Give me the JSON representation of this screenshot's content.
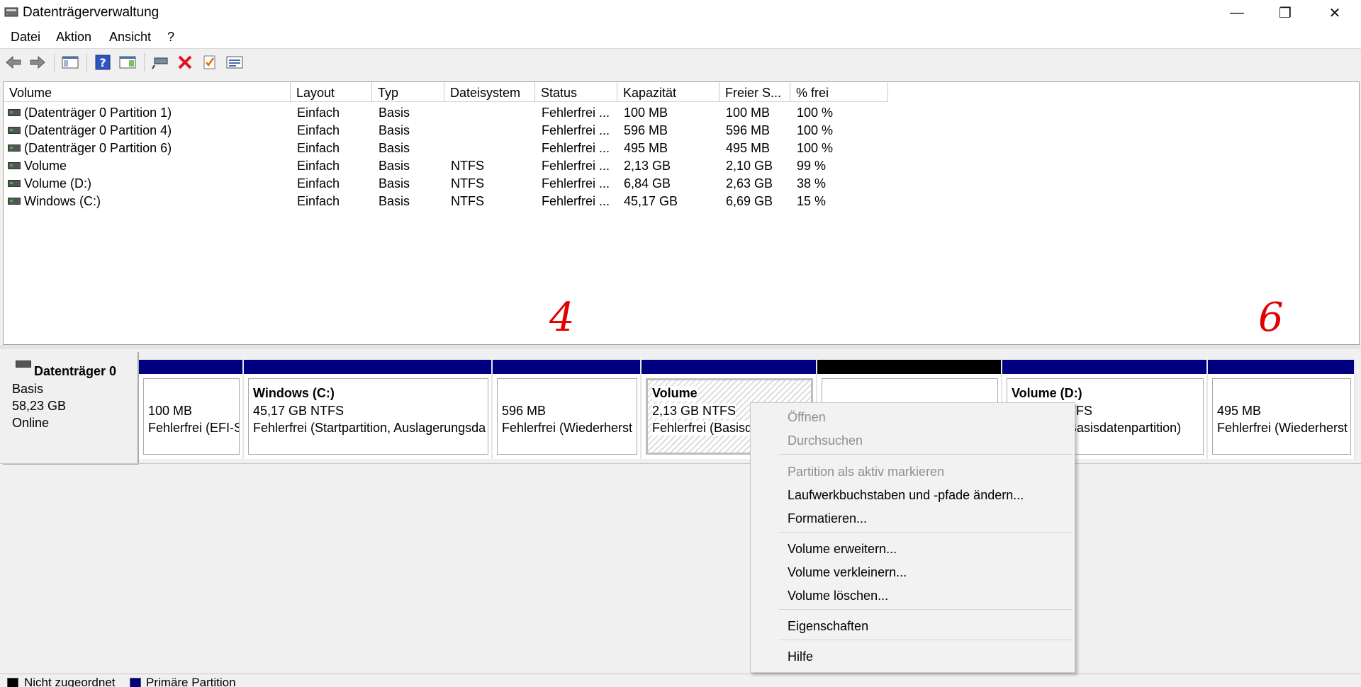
{
  "window": {
    "title": "Datenträgerverwaltung",
    "minimize_glyph": "—",
    "restore_glyph": "❐",
    "close_glyph": "✕"
  },
  "menu": [
    "Datei",
    "Aktion",
    "Ansicht",
    "?"
  ],
  "toolbar_icons": [
    "back-icon",
    "forward-icon",
    "console-tree-icon",
    "help-icon",
    "action-pane-icon",
    "connect-disk-icon",
    "delete-icon",
    "check-icon",
    "properties-icon"
  ],
  "list": {
    "headers": [
      "Volume",
      "Layout",
      "Typ",
      "Dateisystem",
      "Status",
      "Kapazität",
      "Freier S...",
      "% frei"
    ],
    "rows": [
      [
        "(Datenträger 0 Partition 1)",
        "Einfach",
        "Basis",
        "",
        "Fehlerfrei ...",
        "100 MB",
        "100 MB",
        "100 %"
      ],
      [
        "(Datenträger 0 Partition 4)",
        "Einfach",
        "Basis",
        "",
        "Fehlerfrei ...",
        "596 MB",
        "596 MB",
        "100 %"
      ],
      [
        "(Datenträger 0 Partition 6)",
        "Einfach",
        "Basis",
        "",
        "Fehlerfrei ...",
        "495 MB",
        "495 MB",
        "100 %"
      ],
      [
        "Volume",
        "Einfach",
        "Basis",
        "NTFS",
        "Fehlerfrei ...",
        "2,13 GB",
        "2,10 GB",
        "99 %"
      ],
      [
        "Volume (D:)",
        "Einfach",
        "Basis",
        "NTFS",
        "Fehlerfrei ...",
        "6,84 GB",
        "2,63 GB",
        "38 %"
      ],
      [
        "Windows (C:)",
        "Einfach",
        "Basis",
        "NTFS",
        "Fehlerfrei ...",
        "45,17 GB",
        "6,69 GB",
        "15 %"
      ]
    ]
  },
  "disk": {
    "name": "Datenträger 0",
    "type": "Basis",
    "size": "58,23 GB",
    "status": "Online"
  },
  "partitions": {
    "p1": {
      "line2": "100 MB",
      "line3": "Fehlerfrei (EFI-S"
    },
    "c": {
      "name": "Windows  (C:)",
      "line2": "45,17 GB NTFS",
      "line3": "Fehlerfrei (Startpartition, Auslagerungsda"
    },
    "p4": {
      "line2": "596 MB",
      "line3": "Fehlerfrei (Wiederherst"
    },
    "vol": {
      "name": "Volume",
      "line2": "2,13 GB NTFS",
      "line3": "Fehlerfrei (Basisda"
    },
    "d": {
      "name": "Volume  (D:)",
      "line2": "TFS",
      "line3": "Basisdatenpartition)"
    },
    "p6": {
      "line2": "495 MB",
      "line3": "Fehlerfrei (Wiederherst"
    }
  },
  "legend": {
    "unallocated": "Nicht zugeordnet",
    "primary": "Primäre Partition",
    "unallocated_color": "#000000",
    "primary_color": "#000080"
  },
  "context_menu": {
    "open": "Öffnen",
    "explore": "Durchsuchen",
    "mark_active": "Partition als aktiv markieren",
    "change_letter": "Laufwerkbuchstaben und -pfade ändern...",
    "format": "Formatieren...",
    "extend": "Volume erweitern...",
    "shrink": "Volume verkleinern...",
    "delete": "Volume löschen...",
    "properties": "Eigenschaften",
    "help": "Hilfe"
  },
  "annotations": {
    "a1": "4",
    "a2": "6"
  }
}
